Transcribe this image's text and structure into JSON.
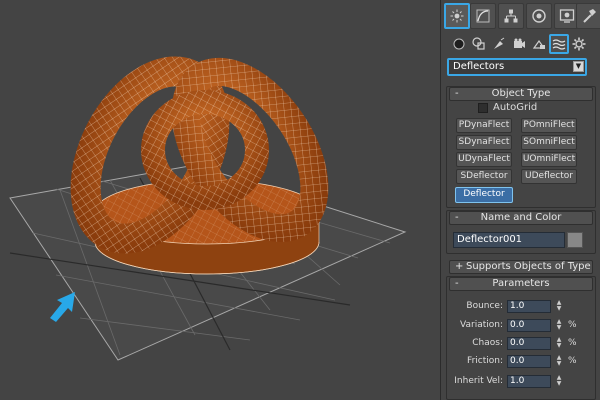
{
  "command_panel": {
    "tabs": [
      {
        "name": "create",
        "icon": "sun-star-icon",
        "active": true
      },
      {
        "name": "modify",
        "icon": "modify-curve-icon",
        "active": false
      },
      {
        "name": "hierarchy",
        "icon": "hierarchy-icon",
        "active": false
      },
      {
        "name": "motion",
        "icon": "motion-circle-icon",
        "active": false
      },
      {
        "name": "display",
        "icon": "display-monitor-icon",
        "active": false
      },
      {
        "name": "utilities",
        "icon": "hammer-icon",
        "active": false
      }
    ],
    "subcategories": [
      {
        "name": "geometry",
        "icon": "sphere-icon"
      },
      {
        "name": "shapes",
        "icon": "shapes-icon"
      },
      {
        "name": "lights",
        "icon": "light-icon"
      },
      {
        "name": "cameras",
        "icon": "camera-icon"
      },
      {
        "name": "helpers",
        "icon": "helper-icon"
      },
      {
        "name": "space-warps",
        "icon": "space-warp-waves-icon",
        "active": true
      },
      {
        "name": "systems",
        "icon": "gear-icon"
      }
    ],
    "category_dropdown": {
      "value": "Deflectors"
    }
  },
  "object_type": {
    "title": "Object Type",
    "collapse_sign": "-",
    "autogrid_label": "AutoGrid",
    "autogrid_checked": false,
    "buttons": [
      {
        "label": "PDynaFlect",
        "active": false
      },
      {
        "label": "POmniFlect",
        "active": false
      },
      {
        "label": "SDynaFlect",
        "active": false
      },
      {
        "label": "SOmniFlect",
        "active": false
      },
      {
        "label": "UDynaFlect",
        "active": false
      },
      {
        "label": "UOmniFlect",
        "active": false
      },
      {
        "label": "SDeflector",
        "active": false
      },
      {
        "label": "UDeflector",
        "active": false
      },
      {
        "label": "Deflector",
        "active": true
      }
    ]
  },
  "name_and_color": {
    "title": "Name and Color",
    "collapse_sign": "-",
    "name_value": "Deflector001",
    "color": "#888888"
  },
  "supports_objects": {
    "title": "Supports Objects of Type",
    "collapse_sign": "+"
  },
  "parameters": {
    "title": "Parameters",
    "collapse_sign": "-",
    "fields": [
      {
        "label": "Bounce:",
        "value": "1.0",
        "unit": ""
      },
      {
        "label": "Variation:",
        "value": "0.0",
        "unit": "%"
      },
      {
        "label": "Chaos:",
        "value": "0.0",
        "unit": "%"
      },
      {
        "label": "Friction:",
        "value": "0.0",
        "unit": "%"
      },
      {
        "label": "Inherit Vel:",
        "value": "1.0",
        "unit": ""
      }
    ]
  },
  "viewport": {
    "background": "#444444",
    "grid_color": "#6a6a6a",
    "object_color": "#c8601c",
    "wire_color": "#f2d2b4",
    "selection_color": "#ffffff",
    "pointer_arrow_color": "#28a8e8"
  }
}
